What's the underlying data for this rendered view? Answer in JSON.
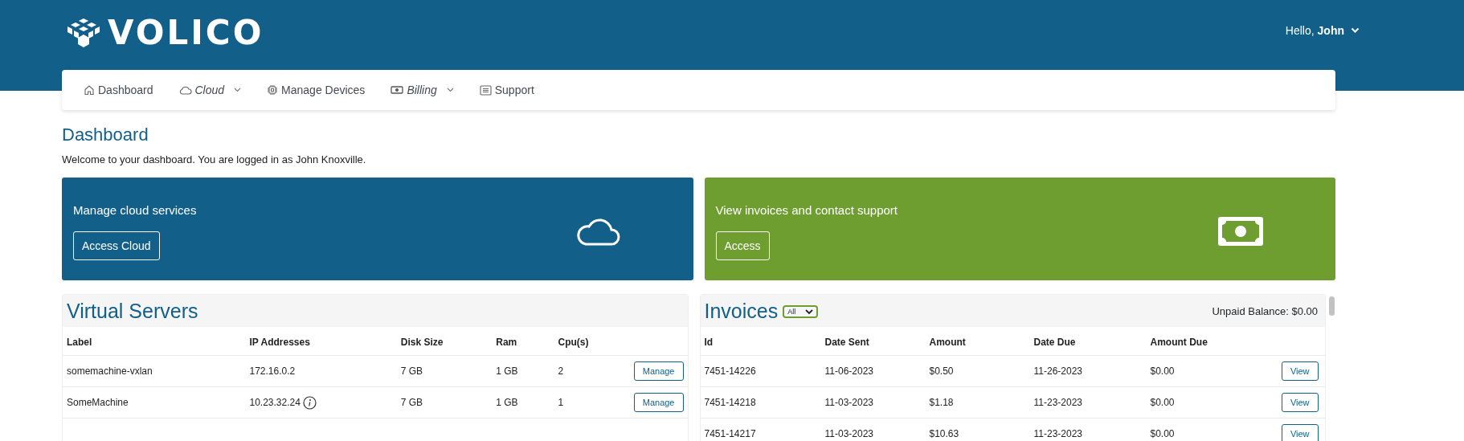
{
  "header": {
    "logo": "VOLICO",
    "user_menu": "Hello, ",
    "user_name": "John"
  },
  "nav": [
    {
      "label": "Dashboard",
      "has_menu": false
    },
    {
      "label": "Cloud",
      "has_menu": true
    },
    {
      "label": "Manage Devices",
      "has_menu": false
    },
    {
      "label": "Billing",
      "has_menu": true
    },
    {
      "label": "Support",
      "has_menu": false
    }
  ],
  "page": {
    "title": "Dashboard",
    "welcome": "Welcome to your dashboard. You are logged in as John Knoxville."
  },
  "cards": [
    {
      "title": "Manage cloud services",
      "button": "Access Cloud",
      "color": "#12608a"
    },
    {
      "title": "View invoices and contact support",
      "button": "Access",
      "color": "#6e9e30"
    }
  ],
  "servers": {
    "title": "Virtual Servers",
    "columns": [
      "Label",
      "IP Addresses",
      "Disk Size",
      "Ram",
      "Cpu(s)"
    ],
    "rows": [
      {
        "label": "somemachine-vxlan",
        "ip": "172.16.0.2",
        "info": false,
        "disk": "7 GB",
        "ram": "1 GB",
        "cpu": "2",
        "button": "Manage"
      },
      {
        "label": "SomeMachine",
        "ip": "10.23.32.24",
        "info": true,
        "disk": "7 GB",
        "ram": "1 GB",
        "cpu": "1",
        "button": "Manage"
      }
    ]
  },
  "invoices": {
    "title": "Invoices",
    "filter": "All",
    "balance": "Unpaid Balance: $0.00",
    "columns": [
      "Id",
      "Date Sent",
      "Amount",
      "Date Due",
      "Amount Due"
    ],
    "rows": [
      {
        "cells": [
          "7451-14226",
          "11-06-2023",
          "$0.50",
          "11-26-2023",
          "$0.00"
        ],
        "button": "View"
      },
      {
        "cells": [
          "7451-14218",
          "11-03-2023",
          "$1.18",
          "11-23-2023",
          "$0.00"
        ],
        "button": "View"
      },
      {
        "cells": [
          "7451-14217",
          "11-03-2023",
          "$10.63",
          "11-23-2023",
          "$0.00"
        ],
        "button": "View"
      }
    ]
  }
}
